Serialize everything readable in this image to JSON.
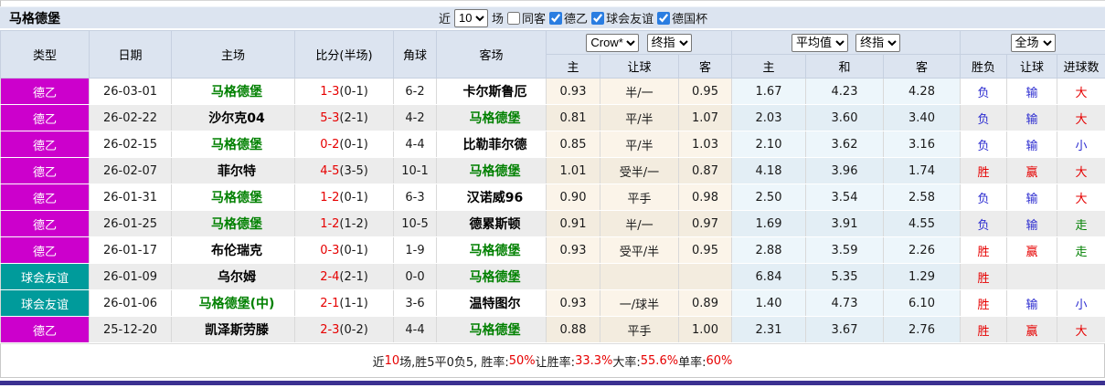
{
  "colors": {
    "league_bg": "#CC00CC",
    "friendly_bg": "#009B9B",
    "red": "#E60000",
    "blue": "#2B2BD0",
    "green": "#008000"
  },
  "title_bar": {
    "team": "马格德堡",
    "recent_label": "近",
    "recent_value": "10",
    "matches_label": "场",
    "checkboxes": [
      {
        "label": "同客",
        "checked": false
      },
      {
        "label": "德乙",
        "checked": true
      },
      {
        "label": "球会友谊",
        "checked": true
      },
      {
        "label": "德国杯",
        "checked": true
      }
    ]
  },
  "header": {
    "static_cols": [
      "类型",
      "日期",
      "主场",
      "比分(半场)",
      "角球",
      "客场"
    ],
    "group1": {
      "select1": "Crow*",
      "select2": "终指",
      "cols": [
        "主",
        "让球",
        "客"
      ]
    },
    "group2": {
      "select1": "平均值",
      "select2": "终指",
      "cols": [
        "主",
        "和",
        "客"
      ]
    },
    "group3": {
      "select1": "全场",
      "cols": [
        "胜负",
        "让球",
        "进球数"
      ]
    }
  },
  "rows": [
    {
      "type": "德乙",
      "league": "league",
      "date": "26-03-01",
      "home": {
        "t": "马格德堡",
        "green": true
      },
      "score": {
        "ft": "1-3",
        "ht": "(0-1)"
      },
      "corners": "6-2",
      "away": {
        "t": "卡尔斯鲁厄",
        "green": false
      },
      "odds": [
        "0.93",
        "半/一",
        "0.95"
      ],
      "avg": [
        "1.67",
        "4.23",
        "4.28"
      ],
      "result": {
        "t": "负",
        "c": "blue"
      },
      "let": {
        "t": "输",
        "c": "blue"
      },
      "goal": {
        "t": "大",
        "c": "red"
      }
    },
    {
      "type": "德乙",
      "league": "league",
      "date": "26-02-22",
      "home": {
        "t": "沙尔克04",
        "green": false
      },
      "score": {
        "ft": "5-3",
        "ht": "(2-1)"
      },
      "corners": "4-2",
      "away": {
        "t": "马格德堡",
        "green": true
      },
      "odds": [
        "0.81",
        "平/半",
        "1.07"
      ],
      "avg": [
        "2.03",
        "3.60",
        "3.40"
      ],
      "result": {
        "t": "负",
        "c": "blue"
      },
      "let": {
        "t": "输",
        "c": "blue"
      },
      "goal": {
        "t": "大",
        "c": "red"
      }
    },
    {
      "type": "德乙",
      "league": "league",
      "date": "26-02-15",
      "home": {
        "t": "马格德堡",
        "green": true
      },
      "score": {
        "ft": "0-2",
        "ht": "(0-1)"
      },
      "corners": "4-4",
      "away": {
        "t": "比勒菲尔德",
        "green": false
      },
      "odds": [
        "0.85",
        "平/半",
        "1.03"
      ],
      "avg": [
        "2.10",
        "3.62",
        "3.16"
      ],
      "result": {
        "t": "负",
        "c": "blue"
      },
      "let": {
        "t": "输",
        "c": "blue"
      },
      "goal": {
        "t": "小",
        "c": "blue"
      }
    },
    {
      "type": "德乙",
      "league": "league",
      "date": "26-02-07",
      "home": {
        "t": "菲尔特",
        "green": false
      },
      "score": {
        "ft": "4-5",
        "ht": "(3-5)"
      },
      "corners": "10-1",
      "away": {
        "t": "马格德堡",
        "green": true
      },
      "odds": [
        "1.01",
        "受半/一",
        "0.87"
      ],
      "avg": [
        "4.18",
        "3.96",
        "1.74"
      ],
      "result": {
        "t": "胜",
        "c": "red"
      },
      "let": {
        "t": "赢",
        "c": "red"
      },
      "goal": {
        "t": "大",
        "c": "red"
      }
    },
    {
      "type": "德乙",
      "league": "league",
      "date": "26-01-31",
      "home": {
        "t": "马格德堡",
        "green": true
      },
      "score": {
        "ft": "1-2",
        "ht": "(0-1)"
      },
      "corners": "6-3",
      "away": {
        "t": "汉诺威96",
        "green": false
      },
      "odds": [
        "0.90",
        "平手",
        "0.98"
      ],
      "avg": [
        "2.50",
        "3.54",
        "2.58"
      ],
      "result": {
        "t": "负",
        "c": "blue"
      },
      "let": {
        "t": "输",
        "c": "blue"
      },
      "goal": {
        "t": "大",
        "c": "red"
      }
    },
    {
      "type": "德乙",
      "league": "league",
      "date": "26-01-25",
      "home": {
        "t": "马格德堡",
        "green": true
      },
      "score": {
        "ft": "1-2",
        "ht": "(1-2)"
      },
      "corners": "10-5",
      "away": {
        "t": "德累斯顿",
        "green": false
      },
      "odds": [
        "0.91",
        "半/一",
        "0.97"
      ],
      "avg": [
        "1.69",
        "3.91",
        "4.55"
      ],
      "result": {
        "t": "负",
        "c": "blue"
      },
      "let": {
        "t": "输",
        "c": "blue"
      },
      "goal": {
        "t": "走",
        "c": "green"
      }
    },
    {
      "type": "德乙",
      "league": "league",
      "date": "26-01-17",
      "home": {
        "t": "布伦瑞克",
        "green": false
      },
      "score": {
        "ft": "0-3",
        "ht": "(0-1)"
      },
      "corners": "1-9",
      "away": {
        "t": "马格德堡",
        "green": true
      },
      "odds": [
        "0.93",
        "受平/半",
        "0.95"
      ],
      "avg": [
        "2.88",
        "3.59",
        "2.26"
      ],
      "result": {
        "t": "胜",
        "c": "red"
      },
      "let": {
        "t": "赢",
        "c": "red"
      },
      "goal": {
        "t": "走",
        "c": "green"
      }
    },
    {
      "type": "球会友谊",
      "league": "friendly",
      "date": "26-01-09",
      "home": {
        "t": "乌尔姆",
        "green": false
      },
      "score": {
        "ft": "2-4",
        "ht": "(2-1)"
      },
      "corners": "0-0",
      "away": {
        "t": "马格德堡",
        "green": true
      },
      "odds": [
        "",
        "",
        ""
      ],
      "avg": [
        "6.84",
        "5.35",
        "1.29"
      ],
      "result": {
        "t": "胜",
        "c": "red"
      },
      "let": {
        "t": "",
        "c": "blue"
      },
      "goal": {
        "t": "",
        "c": "blue"
      }
    },
    {
      "type": "球会友谊",
      "league": "friendly",
      "date": "26-01-06",
      "home": {
        "t": "马格德堡(中)",
        "green": true
      },
      "score": {
        "ft": "2-1",
        "ht": "(1-1)"
      },
      "corners": "3-6",
      "away": {
        "t": "温特图尔",
        "green": false
      },
      "odds": [
        "0.93",
        "一/球半",
        "0.89"
      ],
      "avg": [
        "1.40",
        "4.73",
        "6.10"
      ],
      "result": {
        "t": "胜",
        "c": "red"
      },
      "let": {
        "t": "输",
        "c": "blue"
      },
      "goal": {
        "t": "小",
        "c": "blue"
      }
    },
    {
      "type": "德乙",
      "league": "league",
      "date": "25-12-20",
      "home": {
        "t": "凯泽斯劳滕",
        "green": false
      },
      "score": {
        "ft": "2-3",
        "ht": "(0-2)"
      },
      "corners": "4-4",
      "away": {
        "t": "马格德堡",
        "green": true
      },
      "odds": [
        "0.88",
        "平手",
        "1.00"
      ],
      "avg": [
        "2.31",
        "3.67",
        "2.76"
      ],
      "result": {
        "t": "胜",
        "c": "red"
      },
      "let": {
        "t": "赢",
        "c": "red"
      },
      "goal": {
        "t": "大",
        "c": "red"
      }
    }
  ],
  "footer": {
    "segments": [
      {
        "text": "近",
        "red": false
      },
      {
        "text": "10",
        "red": true
      },
      {
        "text": "场,胜5平0负5, 胜率:",
        "red": false
      },
      {
        "text": "50%",
        "red": true
      },
      {
        "text": " 让胜率:",
        "red": false
      },
      {
        "text": "33.3%",
        "red": true
      },
      {
        "text": " 大率:",
        "red": false
      },
      {
        "text": "55.6%",
        "red": true
      },
      {
        "text": " 单率:",
        "red": false
      },
      {
        "text": "60%",
        "red": true
      }
    ]
  }
}
